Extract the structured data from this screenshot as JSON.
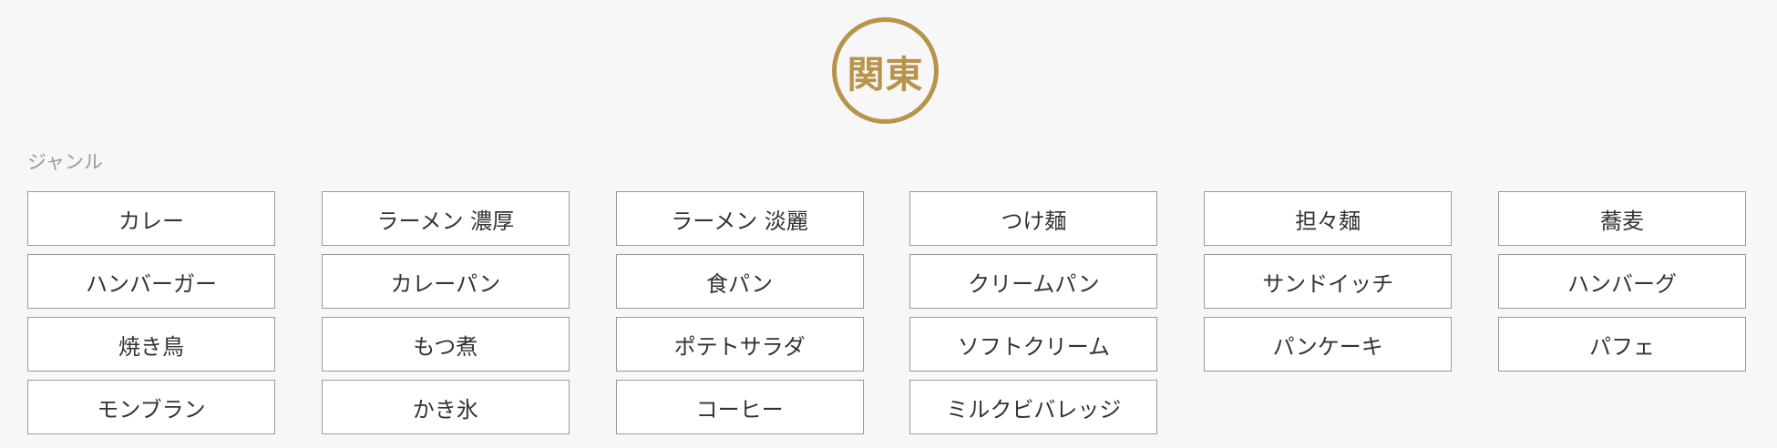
{
  "region": {
    "label": "関東",
    "accent_color": "#b8944b"
  },
  "section": {
    "label": "ジャンル"
  },
  "genres": [
    "カレー",
    "ラーメン 濃厚",
    "ラーメン 淡麗",
    "つけ麺",
    "担々麺",
    "蕎麦",
    "ハンバーガー",
    "カレーパン",
    "食パン",
    "クリームパン",
    "サンドイッチ",
    "ハンバーグ",
    "焼き鳥",
    "もつ煮",
    "ポテトサラダ",
    "ソフトクリーム",
    "パンケーキ",
    "パフェ",
    "モンブラン",
    "かき氷",
    "コーヒー",
    "ミルクビバレッジ"
  ]
}
